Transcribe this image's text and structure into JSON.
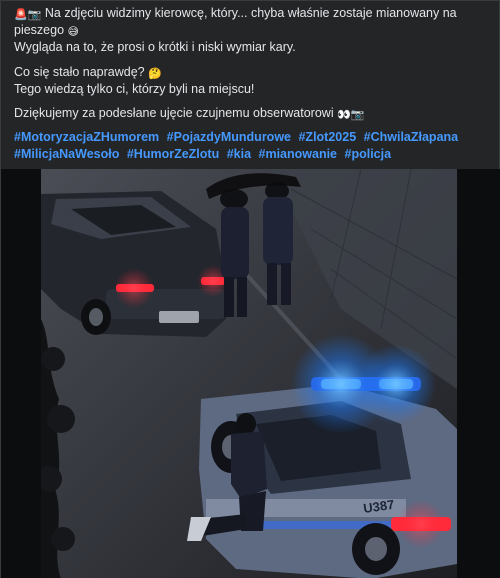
{
  "post": {
    "line1": "Na zdjęciu widzimy kierowcę, który... chyba właśnie zostaje mianowany na pieszego",
    "line1_emoji": "😅",
    "line2": "Wygląda na to, że prosi o krótki i niski wymiar kary.",
    "line3": "Co się stało naprawdę?",
    "line3_emoji": "🤔",
    "line4": "Tego wiedzą tylko ci, którzy byli na miejscu!",
    "line5": "Dziękujemy za podesłane ujęcie czujnemu obserwatorowi",
    "line5_emoji": "👀📷",
    "lead_emoji": "🚨📷",
    "hashtags": [
      "#MotoryzacjaZHumorem",
      "#PojazdyMundurowe",
      "#Zlot2025",
      "#ChwilaZłapana",
      "#MilicjaNaWesoło",
      "#HumorZeZlotu",
      "#kia",
      "#mianowanie",
      "#policja"
    ]
  },
  "photo": {
    "police_car_plate": "U387"
  },
  "colors": {
    "background": "#242526",
    "text": "#e4e6eb",
    "hashtag": "#4599ff",
    "siren_blue": "#3aa0ff",
    "tail_light_red": "#ff2a3a"
  }
}
